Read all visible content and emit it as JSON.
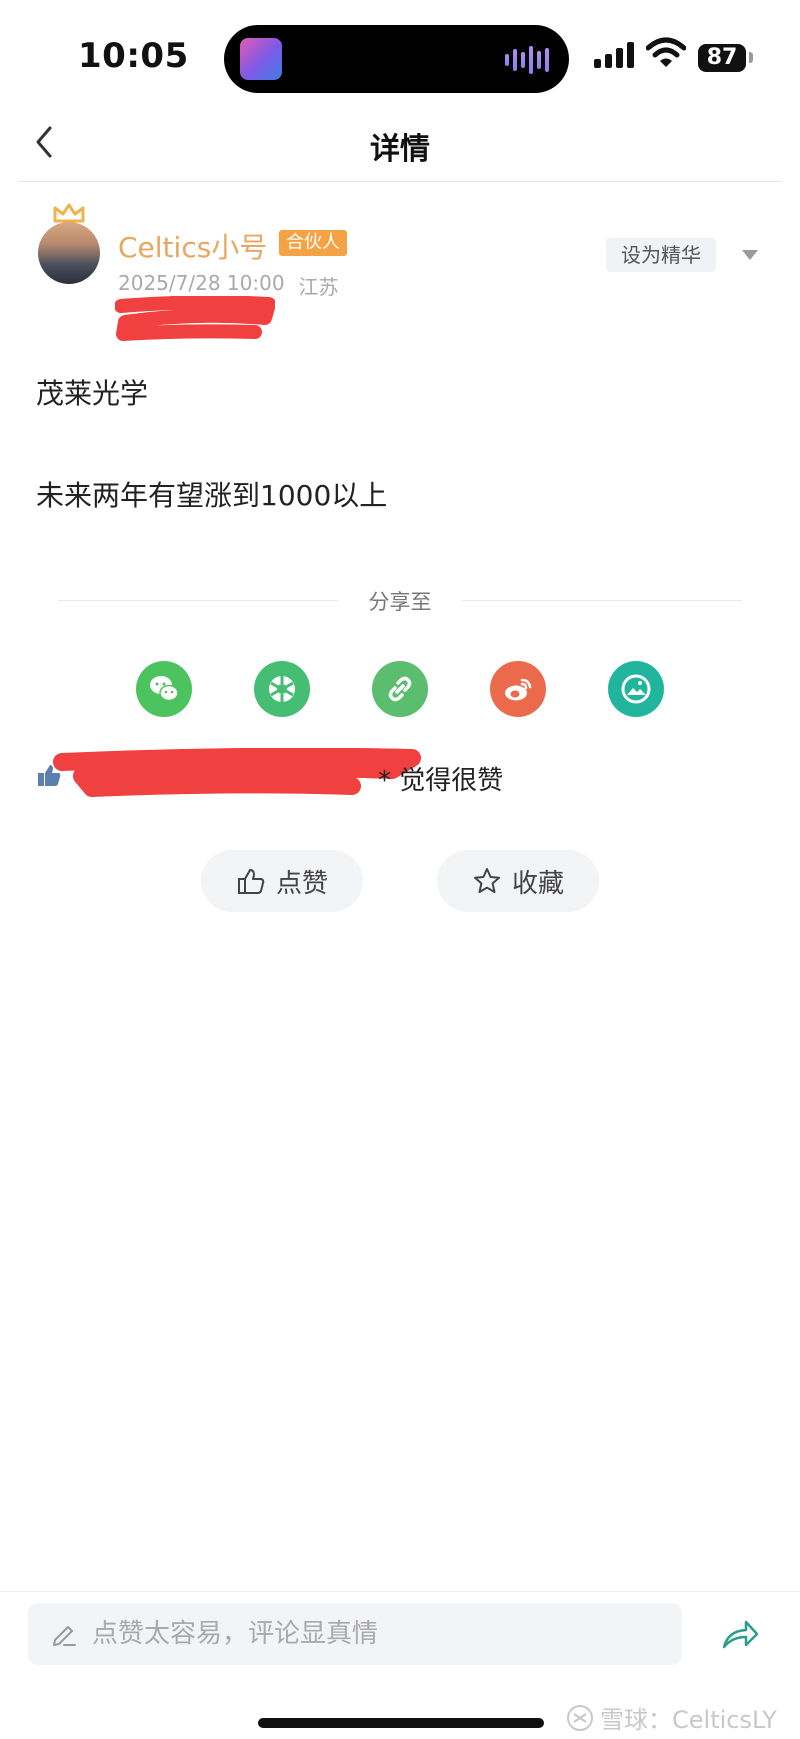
{
  "status_bar": {
    "time": "10:05",
    "battery": "87"
  },
  "nav": {
    "title": "详情"
  },
  "post": {
    "author": "Celtics小号",
    "badge": "合伙人",
    "date": "2025/7/28 10:00",
    "location": "江苏",
    "essence_label": "设为精华",
    "lines": [
      "茂莱光学",
      "未来两年有望涨到1000以上"
    ]
  },
  "share": {
    "label": "分享至",
    "targets": [
      {
        "icon": "wechat-icon",
        "color": "#4cc35f"
      },
      {
        "icon": "moments-icon",
        "color": "#45be73"
      },
      {
        "icon": "link-icon",
        "color": "#5bbd6e"
      },
      {
        "icon": "weibo-icon",
        "color": "#ec6a4c"
      },
      {
        "icon": "image-icon",
        "color": "#22b59d"
      }
    ]
  },
  "likes": {
    "tail": "* 觉得很赞"
  },
  "actions": {
    "like": "点赞",
    "favorite": "收藏"
  },
  "comment": {
    "placeholder": "点赞太容易，评论显真情"
  },
  "watermark": "雪球：CelticsLY"
}
